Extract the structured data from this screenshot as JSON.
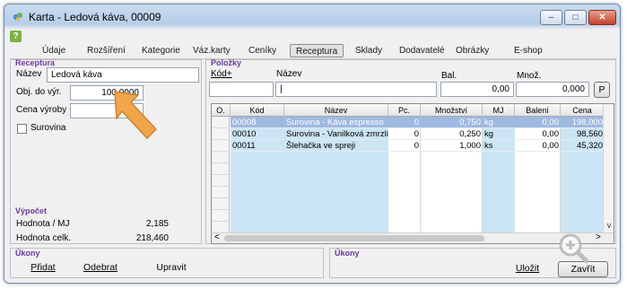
{
  "window": {
    "title": "Karta - Ledová káva, 00009",
    "help_glyph": "?",
    "minimize_glyph": "–",
    "maximize_glyph": "□",
    "close_glyph": "✕"
  },
  "tabs": [
    "Údaje",
    "Rozšíření",
    "Kategorie",
    "Váz.karty",
    "Ceníky",
    "Receptura",
    "Sklady",
    "Dodavatelé",
    "Obrázky",
    "E-shop"
  ],
  "active_tab": "Receptura",
  "receptura": {
    "legend": "Receptura",
    "name_label": "Název",
    "name_value": "Ledová káva",
    "qty_label": "Obj. do výr.",
    "qty_value": "100,0000",
    "price_label": "Cena výroby",
    "price_value": "",
    "surovina_label": "Surovina"
  },
  "polozky": {
    "legend": "Položky",
    "kod_label": "Kód+",
    "nazev_label": "Název",
    "bal_label": "Bal.",
    "bal_value": "0,00",
    "mnoz_label": "Množ.",
    "mnoz_value": "0,000",
    "p_button": "P",
    "columns": [
      "O.",
      "Kód",
      "Název",
      "Pc.",
      "Množství",
      "MJ",
      "Balení",
      "Cena"
    ],
    "rows": [
      {
        "kod": "00008",
        "nazev": "Surovina - Káva espresso",
        "pc": "0",
        "mnozstvi": "0,750",
        "mj": "kg",
        "baleni": "0,00",
        "cena": "198,000"
      },
      {
        "kod": "00010",
        "nazev": "Surovina - Vanilková zmrzlina",
        "pc": "0",
        "mnozstvi": "0,250",
        "mj": "kg",
        "baleni": "0,00",
        "cena": "98,560"
      },
      {
        "kod": "00011",
        "nazev": "Šlehačka ve spreji",
        "pc": "0",
        "mnozstvi": "1,000",
        "mj": "ks",
        "baleni": "0,00",
        "cena": "45,320"
      }
    ],
    "scroll_left": "<",
    "scroll_right": ">",
    "scroll_down": "v"
  },
  "vypocet": {
    "legend": "Výpočet",
    "hodnota_mj_label": "Hodnota / MJ",
    "hodnota_mj_value": "2,185",
    "hodnota_celk_label": "Hodnota celk.",
    "hodnota_celk_value": "218,460"
  },
  "ukony_left": {
    "legend": "Úkony",
    "pridat": "Přidat",
    "odebrat": "Odebrat",
    "upravit": "Upravit"
  },
  "ukony_right": {
    "legend": "Úkony",
    "ulozit": "Uložit",
    "zavrit": "Zavřít"
  },
  "colors": {
    "legend": "#6a3b9a",
    "grid_selected": "#9fb9e0",
    "grid_cyan": "#cbe5f4",
    "arrow": "#f2a64c"
  }
}
